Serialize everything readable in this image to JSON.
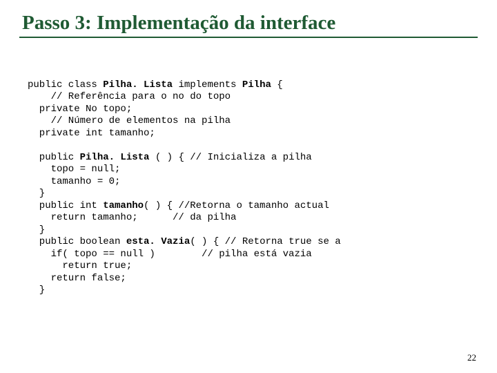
{
  "title": "Passo 3:  Implementação da interface",
  "page_number": "22",
  "code": {
    "l1a": "public class ",
    "l1b": "Pilha. Lista",
    "l1c": " implements ",
    "l1d": "Pilha",
    "l1e": " {",
    "l2": "    // Referência para o no do topo",
    "l3": "  private No topo;",
    "l4": "    // Número de elementos na pilha",
    "l5": "  private int tamanho;",
    "blank1": "",
    "l6a": "  public ",
    "l6b": "Pilha. Lista",
    "l6c": " ( ) { // Inicializa a pilha",
    "l7": "    topo = null;",
    "l8": "    tamanho = 0;",
    "l9": "  }",
    "l10a": "  public int ",
    "l10b": "tamanho",
    "l10c": "( ) { //Retorna o tamanho actual",
    "l11": "    return tamanho;      // da pilha",
    "l12": "  }",
    "l13a": "  public boolean ",
    "l13b": "esta. Vazia",
    "l13c": "( ) { // Retorna true se a",
    "l14": "    if( topo == null )        // pilha está vazia",
    "l15": "      return true;",
    "l16": "    return false;",
    "l17": "  }"
  }
}
